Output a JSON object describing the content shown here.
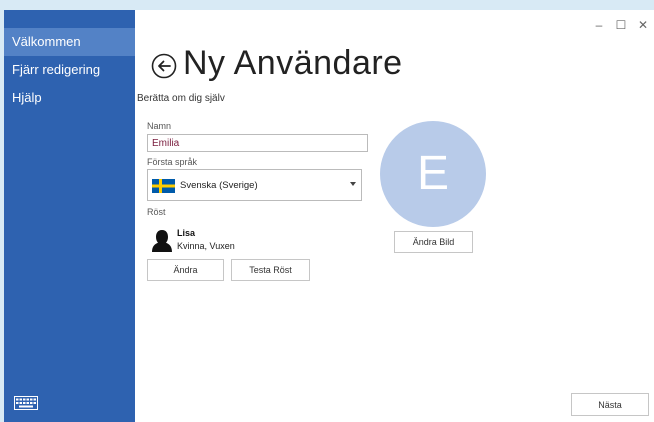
{
  "sidebar": {
    "items": [
      {
        "label": "Välkommen",
        "active": true
      },
      {
        "label": "Fjärr redigering",
        "active": false
      },
      {
        "label": "Hjälp",
        "active": false
      }
    ],
    "bottom_icon": "keyboard-icon"
  },
  "window": {
    "minimize": "–",
    "maximize": "☐",
    "close": "✕"
  },
  "header": {
    "back_icon": "back-arrow-icon",
    "title": "Ny Användare",
    "subtitle": "Berätta om dig själv"
  },
  "form": {
    "name_label": "Namn",
    "name_value": "Emilia",
    "language_label": "Första språk",
    "language_value": "Svenska (Sverige)",
    "language_flag": "flag-sweden-icon",
    "voice_label": "Röst",
    "voice_name": "Lisa",
    "voice_desc": "Kvinna, Vuxen",
    "change_button": "Ändra",
    "test_voice_button": "Testa Röst"
  },
  "avatar": {
    "initial": "E",
    "change_image_button": "Ändra Bild"
  },
  "footer": {
    "next_button": "Nästa"
  },
  "colors": {
    "sidebar": "#2e62b0",
    "sidebar_active": "#5382c6",
    "avatar_bg": "#b8cbe9",
    "name_text": "#7a1d3e",
    "flag_blue": "#005BAA",
    "flag_yellow": "#FECC00"
  }
}
